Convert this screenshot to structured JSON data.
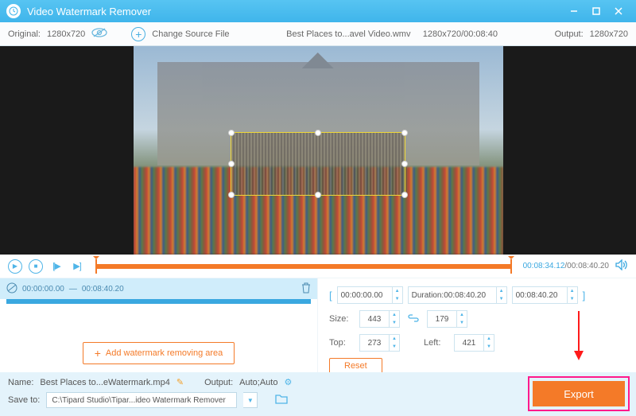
{
  "titlebar": {
    "title": "Video Watermark Remover"
  },
  "toolbar": {
    "original_label": "Original:",
    "original_res": "1280x720",
    "change_source": "Change Source File",
    "filename": "Best Places to...avel Video.wmv",
    "file_meta": "1280x720/00:08:40",
    "output_label": "Output:",
    "output_res": "1280x720"
  },
  "controls": {
    "current_time": "00:08:34.12",
    "total_time": "/00:08:40.20"
  },
  "segment": {
    "start": "00:00:00.00",
    "sep": "—",
    "end": "00:08:40.20"
  },
  "add_area": "Add watermark removing area",
  "range": {
    "start": "00:00:00.00",
    "duration_label": "Duration:",
    "duration": "00:08:40.20",
    "end": "00:08:40.20"
  },
  "size": {
    "label": "Size:",
    "w": "443",
    "h": "179"
  },
  "pos": {
    "top_label": "Top:",
    "top": "273",
    "left_label": "Left:",
    "left": "421"
  },
  "reset": "Reset",
  "bottom": {
    "name_label": "Name:",
    "name": "Best Places to...eWatermark.mp4",
    "output_label": "Output:",
    "output": "Auto;Auto",
    "save_label": "Save to:",
    "save": "C:\\Tipard Studio\\Tipar...ideo Watermark Remover",
    "export": "Export"
  }
}
